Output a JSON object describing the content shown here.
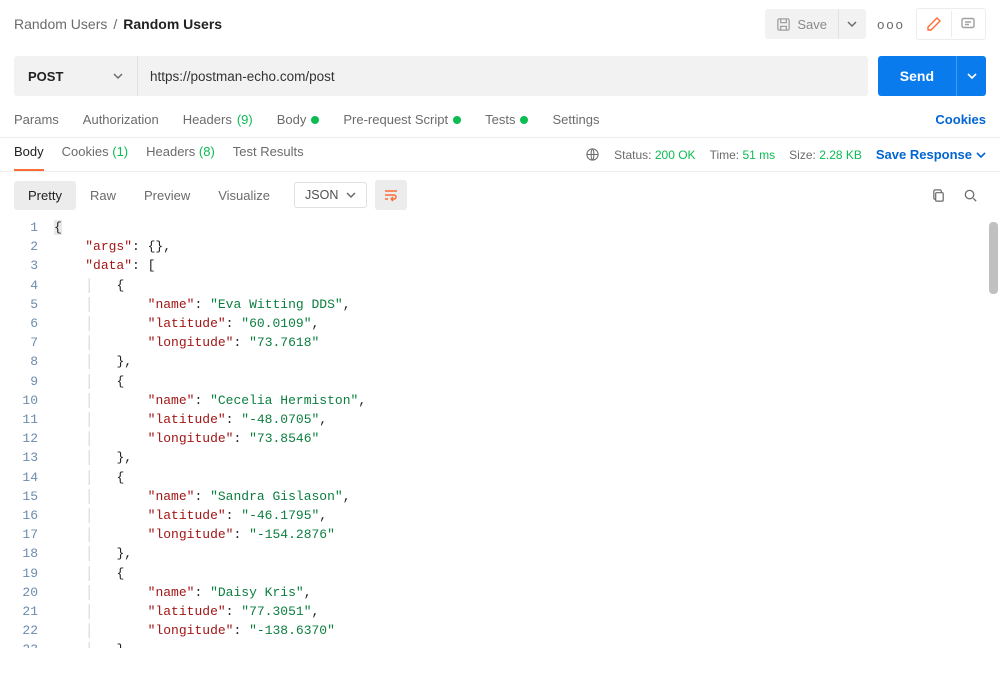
{
  "breadcrumb": {
    "root": "Random Users",
    "leaf": "Random Users",
    "sep": "/"
  },
  "topbar": {
    "save_label": "Save",
    "more_label": "ooo"
  },
  "request": {
    "method": "POST",
    "url": "https://postman-echo.com/post",
    "send_label": "Send"
  },
  "reqtabs": {
    "params": "Params",
    "auth": "Authorization",
    "headers": "Headers",
    "headers_count": "(9)",
    "body": "Body",
    "prereq": "Pre-request Script",
    "tests": "Tests",
    "settings": "Settings"
  },
  "cookies_link": "Cookies",
  "resptabs": {
    "body": "Body",
    "cookies": "Cookies",
    "cookies_count": "(1)",
    "headers": "Headers",
    "headers_count": "(8)",
    "test": "Test Results"
  },
  "metrics": {
    "status_label": "Status:",
    "status_val": "200 OK",
    "time_label": "Time:",
    "time_val": "51 ms",
    "size_label": "Size:",
    "size_val": "2.28 KB"
  },
  "save_response": "Save Response",
  "viewtabs": {
    "pretty": "Pretty",
    "raw": "Raw",
    "preview": "Preview",
    "visualize": "Visualize"
  },
  "format_sel": "JSON",
  "code": {
    "open_brace": "{",
    "args_key": "\"args\"",
    "args_val": "{}",
    "data_key": "\"data\"",
    "open_arr": "[",
    "name_key": "\"name\"",
    "lat_key": "\"latitude\"",
    "lon_key": "\"longitude\"",
    "rows": [
      {
        "name": "\"Eva Witting DDS\"",
        "lat": "\"60.0109\"",
        "lon": "\"73.7618\""
      },
      {
        "name": "\"Cecelia Hermiston\"",
        "lat": "\"-48.0705\"",
        "lon": "\"73.8546\""
      },
      {
        "name": "\"Sandra Gislason\"",
        "lat": "\"-46.1795\"",
        "lon": "\"-154.2876\""
      },
      {
        "name": "\"Daisy Kris\"",
        "lat": "\"77.3051\"",
        "lon": "\"-138.6370\""
      }
    ],
    "obj_open": "{",
    "obj_close": "},",
    "colon": ": ",
    "comma": ","
  }
}
